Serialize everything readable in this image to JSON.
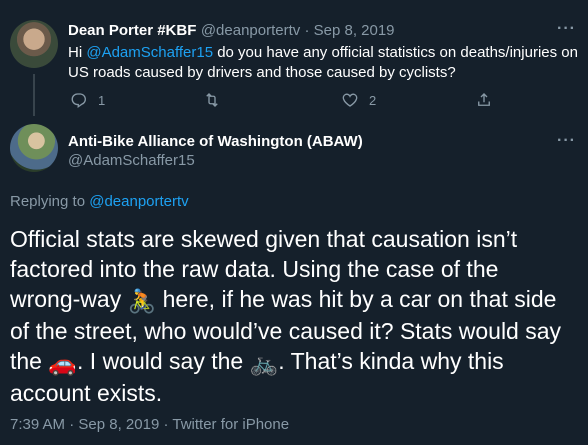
{
  "tweet1": {
    "name": "Dean Porter #KBF",
    "handle": "@deanportertv",
    "separator": " · ",
    "date": "Sep 8, 2019",
    "text_before": "Hi ",
    "mention": "@AdamSchaffer15",
    "text_after": " do you have any official statistics on deaths/injuries on US roads caused by drivers and those caused by cyclists?",
    "reply_count": "1",
    "retweet_count": "",
    "like_count": "2",
    "more": "···"
  },
  "tweet2": {
    "name": "Anti-Bike Alliance of Washington (ABAW)",
    "handle": "@AdamSchaffer15",
    "more": "···",
    "replying_label": "Replying to ",
    "replying_to": "@deanportertv",
    "text_line1": "Official stats are skewed given that causation isn’t",
    "text_line2": "factored into the raw data. Using the case of the",
    "text_line3a": "wrong-way ",
    "text_line3b": " here, if he was hit by a car on that side",
    "text_line4": "of the street, who would’ve caused it? Stats would say",
    "text_line5a": "the ",
    "text_line5b": ". I would say the ",
    "text_line5c": ". That’s kinda why this",
    "text_line6": "account exists.",
    "emoji_cyclist": "🚴",
    "emoji_car": "🚗",
    "emoji_bike": "🚲",
    "time": "7:39 AM",
    "separator": " · ",
    "date": "Sep 8, 2019",
    "source_sep": " · ",
    "source": "Twitter for iPhone"
  },
  "icons": {
    "reply": "reply-icon",
    "retweet": "retweet-icon",
    "like": "heart-icon",
    "share": "share-icon"
  },
  "colors": {
    "background": "#15202b",
    "accent": "#1da1f2",
    "muted": "#8899a6"
  }
}
